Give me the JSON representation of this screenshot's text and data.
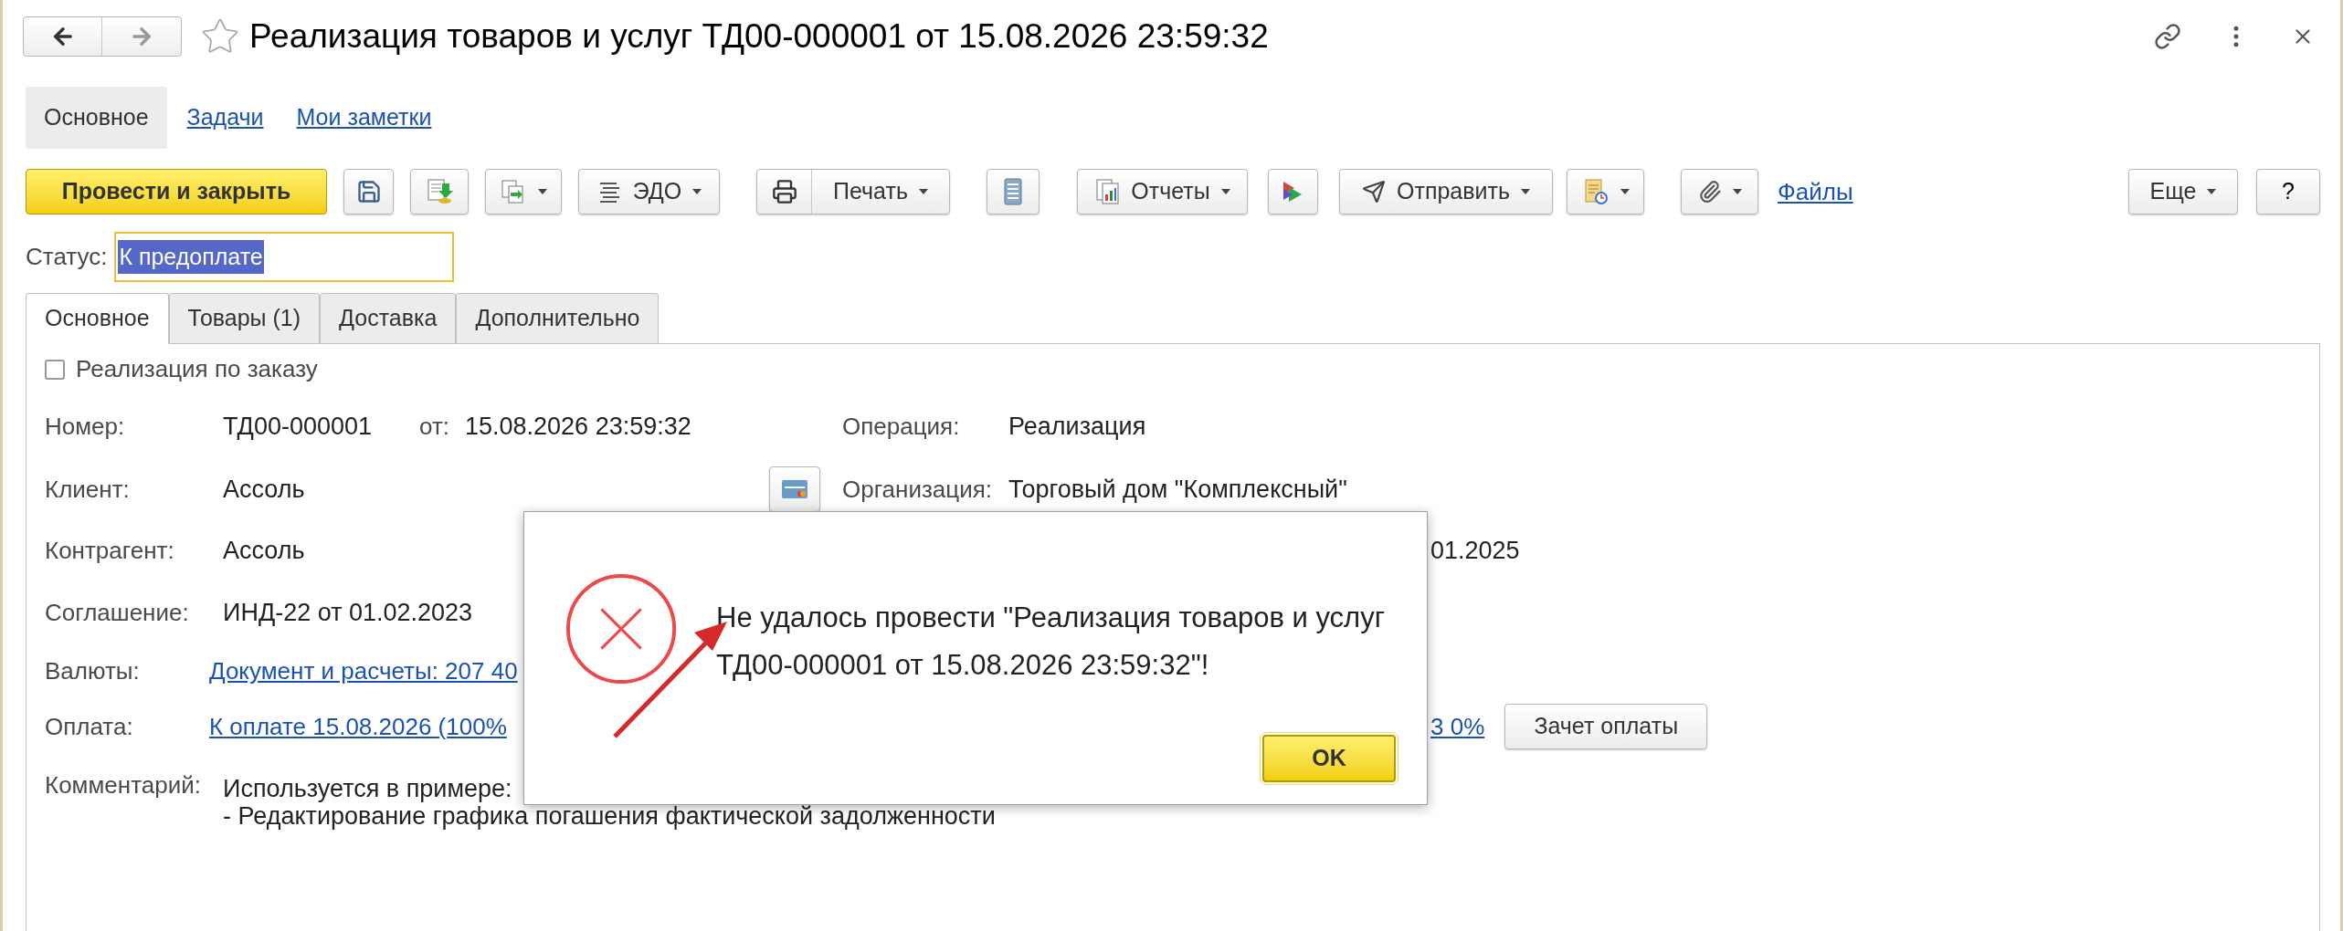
{
  "window": {
    "title": "Реализация товаров и услуг ТД00-000001 от 15.08.2026 23:59:32"
  },
  "sections": [
    {
      "label": "Основное",
      "selected": true
    },
    {
      "label": "Задачи",
      "selected": false
    },
    {
      "label": "Мои заметки",
      "selected": false
    }
  ],
  "toolbar": {
    "post_close": "Провести и закрыть",
    "edo": "ЭДО",
    "print": "Печать",
    "reports": "Отчеты",
    "send": "Отправить",
    "files": "Файлы",
    "more": "Еще",
    "help": "?"
  },
  "status": {
    "label": "Статус:",
    "value": "К предоплате"
  },
  "tabs": [
    {
      "label": "Основное",
      "selected": true
    },
    {
      "label": "Товары (1)",
      "selected": false
    },
    {
      "label": "Доставка",
      "selected": false
    },
    {
      "label": "Дополнительно",
      "selected": false
    }
  ],
  "by_order": {
    "label": "Реализация по заказу",
    "checked": false
  },
  "fields": {
    "number_label": "Номер:",
    "number": "ТД00-000001",
    "date_label": "от:",
    "date": "15.08.2026 23:59:32",
    "operation_label": "Операция:",
    "operation": "Реализация",
    "client_label": "Клиент:",
    "client": "Ассоль",
    "organization_label": "Организация:",
    "organization": "Торговый дом \"Комплексный\"",
    "counterparty_label": "Контрагент:",
    "counterparty": "Ассоль",
    "counterparty_extra": "01.2025",
    "agreement_label": "Соглашение:",
    "agreement": "ИНД-22 от 01.02.2023",
    "currency_label": "Валюты:",
    "currency_link": "Документ и расчеты: 207 40",
    "payment_label": "Оплата:",
    "payment_link": "К оплате 15.08.2026 (100%",
    "payment_extra": "3 0%",
    "offset_button": "Зачет оплаты",
    "comment_label": "Комментарий:",
    "comment_lines": [
      "Используется в примере:",
      "- Редактирование графика погашения фактической задолженности"
    ]
  },
  "dialog": {
    "message": "Не удалось провести \"Реализация товаров и услуг ТД00-000001 от 15.08.2026 23:59:32\"!",
    "ok": "OK"
  }
}
